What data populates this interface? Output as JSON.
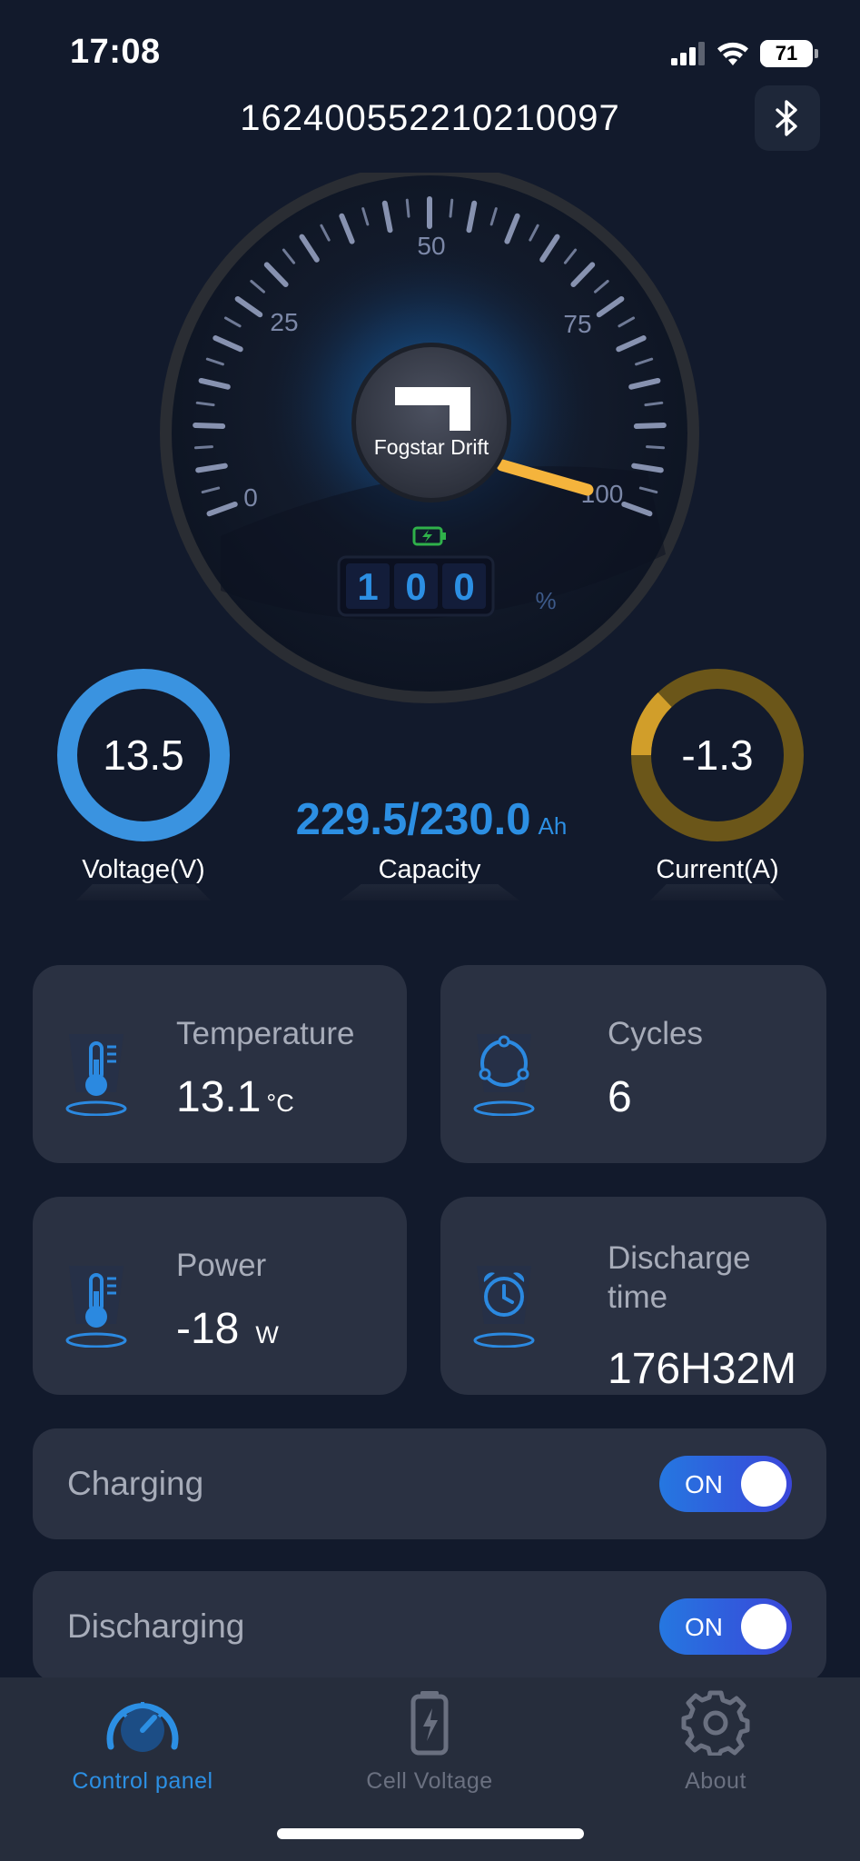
{
  "status_bar": {
    "time": "17:08",
    "battery_level": "71"
  },
  "header": {
    "title": "162400552210210097",
    "bluetooth_icon": "bluetooth-icon"
  },
  "gauge": {
    "brand": "Fogstar Drift",
    "scale_labels": [
      "0",
      "25",
      "50",
      "75",
      "100"
    ],
    "digits": [
      "1",
      "0",
      "0"
    ],
    "percent_unit": "%",
    "value_percent": 100,
    "accent_color": "#f5b43c"
  },
  "voltage": {
    "value": "13.5",
    "label": "Voltage(V)",
    "color": "#3a93e0"
  },
  "capacity": {
    "value": "229.5/230.0",
    "unit": "Ah",
    "label": "Capacity"
  },
  "current": {
    "value": "-1.3",
    "label": "Current(A)",
    "color": "#6b5619",
    "accent": "#d19e2a"
  },
  "cards": {
    "temperature": {
      "label": "Temperature",
      "value": "13.1",
      "unit": "°C",
      "icon": "thermometer-icon"
    },
    "cycles": {
      "label": "Cycles",
      "value": "6",
      "icon": "cycle-icon"
    },
    "power": {
      "label": "Power",
      "value": "-18",
      "unit": "W",
      "icon": "thermometer-icon"
    },
    "discharge_time": {
      "label": "Discharge time",
      "value": "176H32M",
      "icon": "alarm-clock-icon"
    }
  },
  "toggles": {
    "charging": {
      "label": "Charging",
      "state": "ON"
    },
    "discharging": {
      "label": "Discharging",
      "state": "ON"
    }
  },
  "tabs": [
    {
      "label": "Control panel",
      "icon": "speedometer-icon",
      "active": true
    },
    {
      "label": "Cell Voltage",
      "icon": "battery-icon",
      "active": false
    },
    {
      "label": "About",
      "icon": "gear-icon",
      "active": false
    }
  ],
  "colors": {
    "background": "#121a2c",
    "card": "#2a3142",
    "accent_blue": "#2c8fe3",
    "inactive": "#6a7080"
  }
}
